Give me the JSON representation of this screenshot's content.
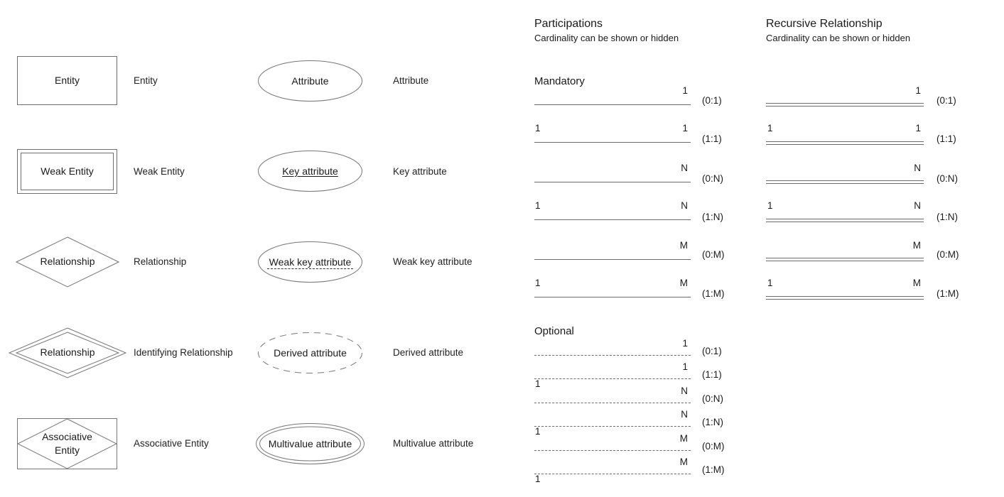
{
  "symbols_entities": [
    {
      "shape": "rectangle",
      "inner_text": "Entity",
      "label": "Entity"
    },
    {
      "shape": "double-rectangle",
      "inner_text": "Weak Entity",
      "label": "Weak Entity"
    },
    {
      "shape": "diamond",
      "inner_text": "Relationship",
      "label": "Relationship"
    },
    {
      "shape": "double-diamond",
      "inner_text": "Relationship",
      "label": "Identifying Relationship"
    },
    {
      "shape": "diamond-in-rectangle",
      "inner_text": "Associative Entity",
      "inner_text_line1": "Associative",
      "inner_text_line2": "Entity",
      "label": "Associative Entity"
    }
  ],
  "symbols_attributes": [
    {
      "shape": "ellipse",
      "inner_text": "Attribute",
      "label": "Attribute",
      "underline": "none"
    },
    {
      "shape": "ellipse",
      "inner_text": "Key attribute",
      "label": "Key attribute",
      "underline": "solid"
    },
    {
      "shape": "ellipse",
      "inner_text": "Weak key attribute",
      "label": "Weak key attribute",
      "underline": "dashed"
    },
    {
      "shape": "dashed-ellipse",
      "inner_text": "Derived attribute",
      "label": "Derived attribute",
      "underline": "none"
    },
    {
      "shape": "double-ellipse",
      "inner_text": "Multivalue attribute",
      "label": "Multivalue attribute",
      "underline": "none"
    }
  ],
  "participations": {
    "title": "Participations",
    "subtitle": "Cardinality can be shown or hidden",
    "groups": [
      {
        "name": "Mandatory",
        "line_style": "solid",
        "rows": [
          {
            "left": "",
            "right": "1",
            "cardinality": "(0:1)"
          },
          {
            "left": "1",
            "right": "1",
            "cardinality": "(1:1)"
          },
          {
            "left": "",
            "right": "N",
            "cardinality": "(0:N)"
          },
          {
            "left": "1",
            "right": "N",
            "cardinality": "(1:N)"
          },
          {
            "left": "",
            "right": "M",
            "cardinality": "(0:M)"
          },
          {
            "left": "1",
            "right": "M",
            "cardinality": "(1:M)"
          }
        ]
      },
      {
        "name": "Optional",
        "line_style": "dashed",
        "rows": [
          {
            "left": "",
            "right": "1",
            "cardinality": "(0:1)"
          },
          {
            "left": "1",
            "right": "1",
            "cardinality": "(1:1)"
          },
          {
            "left": "",
            "right": "N",
            "cardinality": "(0:N)"
          },
          {
            "left": "1",
            "right": "N",
            "cardinality": "(1:N)"
          },
          {
            "left": "",
            "right": "M",
            "cardinality": "(0:M)"
          },
          {
            "left": "1",
            "right": "M",
            "cardinality": "(1:M)"
          }
        ]
      }
    ]
  },
  "recursive": {
    "title": "Recursive Relationship",
    "subtitle": "Cardinality can be shown or hidden",
    "line_style": "double",
    "rows": [
      {
        "left": "",
        "right": "1",
        "cardinality": "(0:1)"
      },
      {
        "left": "1",
        "right": "1",
        "cardinality": "(1:1)"
      },
      {
        "left": "",
        "right": "N",
        "cardinality": "(0:N)"
      },
      {
        "left": "1",
        "right": "N",
        "cardinality": "(1:N)"
      },
      {
        "left": "",
        "right": "M",
        "cardinality": "(0:M)"
      },
      {
        "left": "1",
        "right": "M",
        "cardinality": "(1:M)"
      }
    ]
  },
  "colors": {
    "shape_stroke": "#777777",
    "text": "#1a1a1a",
    "background": "#ffffff"
  }
}
